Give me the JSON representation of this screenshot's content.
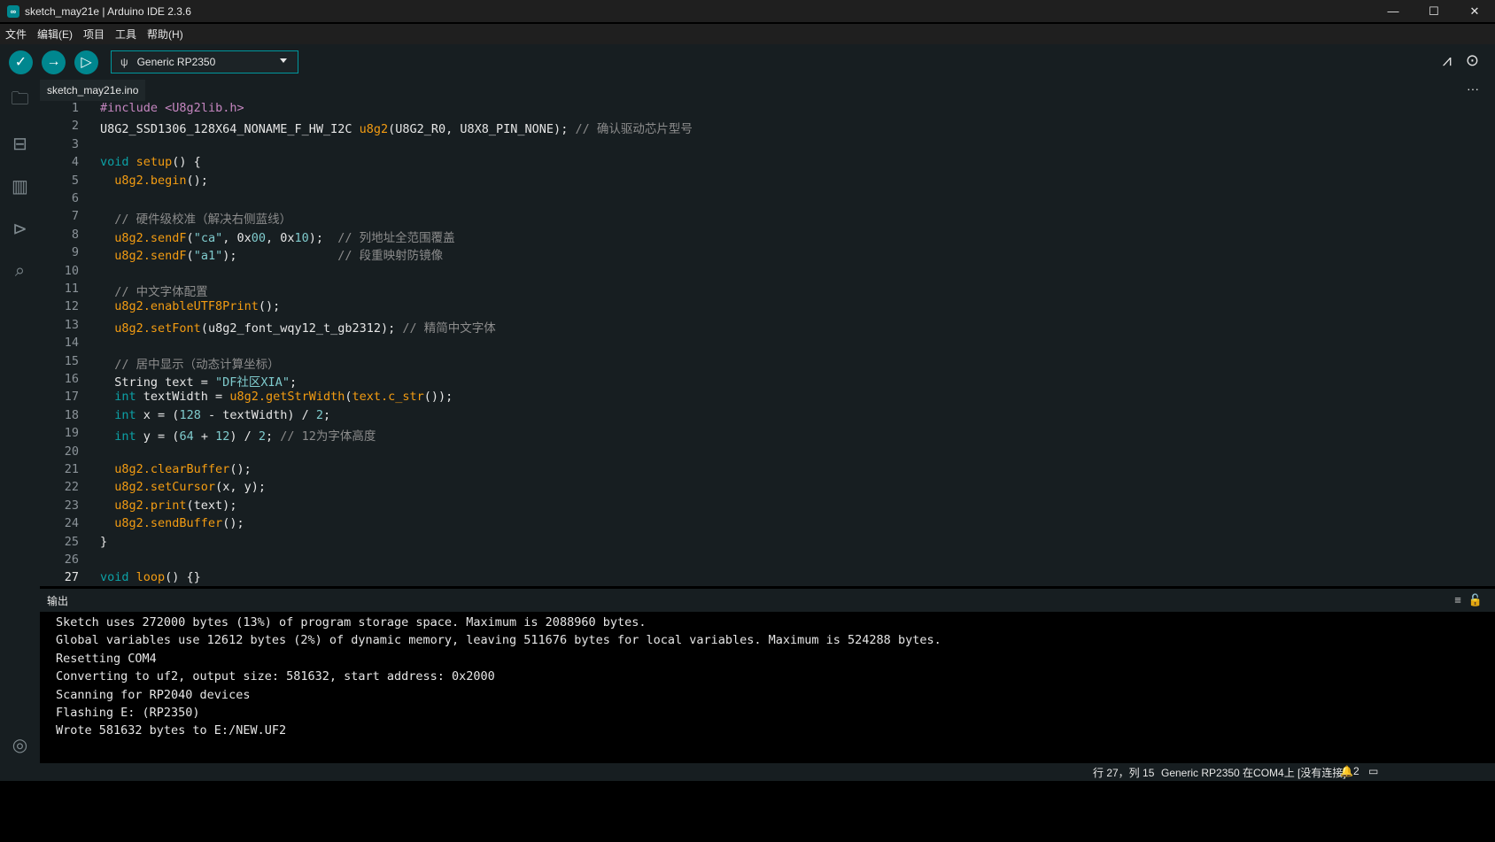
{
  "window": {
    "title": "sketch_may21e | Arduino IDE 2.3.6",
    "logo_icon": "arduino-logo-icon"
  },
  "menu": [
    "文件",
    "编辑(E)",
    "项目",
    "工具",
    "帮助(H)"
  ],
  "toolbar": {
    "verify_icon": "✓",
    "upload_icon": "→",
    "debug_icon": "▷",
    "board": "Generic RP2350"
  },
  "tab": {
    "filename": "sketch_may21e.ino"
  },
  "code_lines": [
    {
      "n": "1",
      "html": "<span class='p'>#include</span> <span class='p'>&lt;U8g2lib.h&gt;</span>"
    },
    {
      "n": "2",
      "html": "U8G2_SSD1306_128X64_NONAME_F_HW_I2C <span class='f'>u8g2</span>(U8G2_R0, U8X8_PIN_NONE); <span class='c'>// 确认驱动芯片型号</span>"
    },
    {
      "n": "3",
      "html": ""
    },
    {
      "n": "4",
      "html": "<span class='k'>void</span> <span class='f'>setup</span>() {"
    },
    {
      "n": "5",
      "html": "  <span class='f'>u8g2.begin</span>();"
    },
    {
      "n": "6",
      "html": ""
    },
    {
      "n": "7",
      "html": "  <span class='c'>// 硬件级校准（解决右侧蓝线）</span>"
    },
    {
      "n": "8",
      "html": "  <span class='f'>u8g2.sendF</span>(<span class='s'>\"ca\"</span>, 0x<span class='s'>00</span>, 0x<span class='s'>10</span>);  <span class='c'>// 列地址全范围覆盖</span>"
    },
    {
      "n": "9",
      "html": "  <span class='f'>u8g2.sendF</span>(<span class='s'>\"a1\"</span>);              <span class='c'>// 段重映射防镜像</span>"
    },
    {
      "n": "10",
      "html": ""
    },
    {
      "n": "11",
      "html": "  <span class='c'>// 中文字体配置</span>"
    },
    {
      "n": "12",
      "html": "  <span class='f'>u8g2.enableUTF8Print</span>();"
    },
    {
      "n": "13",
      "html": "  <span class='f'>u8g2.setFont</span>(u8g2_font_wqy12_t_gb2312); <span class='c'>// 精简中文字体</span>"
    },
    {
      "n": "14",
      "html": ""
    },
    {
      "n": "15",
      "html": "  <span class='c'>// 居中显示（动态计算坐标）</span>"
    },
    {
      "n": "16",
      "html": "  String text = <span class='s'>\"DF社区XIA\"</span>;"
    },
    {
      "n": "17",
      "html": "  <span class='k'>int</span> textWidth = <span class='f'>u8g2.getStrWidth</span>(<span class='f'>text.c_str</span>());"
    },
    {
      "n": "18",
      "html": "  <span class='k'>int</span> x = (<span class='s'>128</span> - textWidth) / <span class='s'>2</span>;"
    },
    {
      "n": "19",
      "html": "  <span class='k'>int</span> y = (<span class='s'>64</span> + <span class='s'>12</span>) / <span class='s'>2</span>; <span class='c'>// 12为字体高度</span>"
    },
    {
      "n": "20",
      "html": ""
    },
    {
      "n": "21",
      "html": "  <span class='f'>u8g2.clearBuffer</span>();"
    },
    {
      "n": "22",
      "html": "  <span class='f'>u8g2.setCursor</span>(x, y);"
    },
    {
      "n": "23",
      "html": "  <span class='f'>u8g2.print</span>(text);"
    },
    {
      "n": "24",
      "html": "  <span class='f'>u8g2.sendBuffer</span>();"
    },
    {
      "n": "25",
      "html": "}"
    },
    {
      "n": "26",
      "html": ""
    },
    {
      "n": "27",
      "html": "<span class='k'>void</span> <span class='f'>loop</span>() {}"
    }
  ],
  "output": {
    "title": "输出",
    "lines": [
      "Sketch uses 272000 bytes (13%) of program storage space. Maximum is 2088960 bytes.",
      "Global variables use 12612 bytes (2%) of dynamic memory, leaving 511676 bytes for local variables. Maximum is 524288 bytes.",
      "Resetting COM4",
      "Converting to uf2, output size: 581632, start address: 0x2000",
      "Scanning for RP2040 devices",
      "Flashing E: (RP2350)",
      "Wrote 581632 bytes to E:/NEW.UF2"
    ]
  },
  "status": {
    "cursor": "行 27，列 15",
    "board_port": "Generic RP2350 在COM4上 [没有连接]",
    "notifications": "2"
  }
}
